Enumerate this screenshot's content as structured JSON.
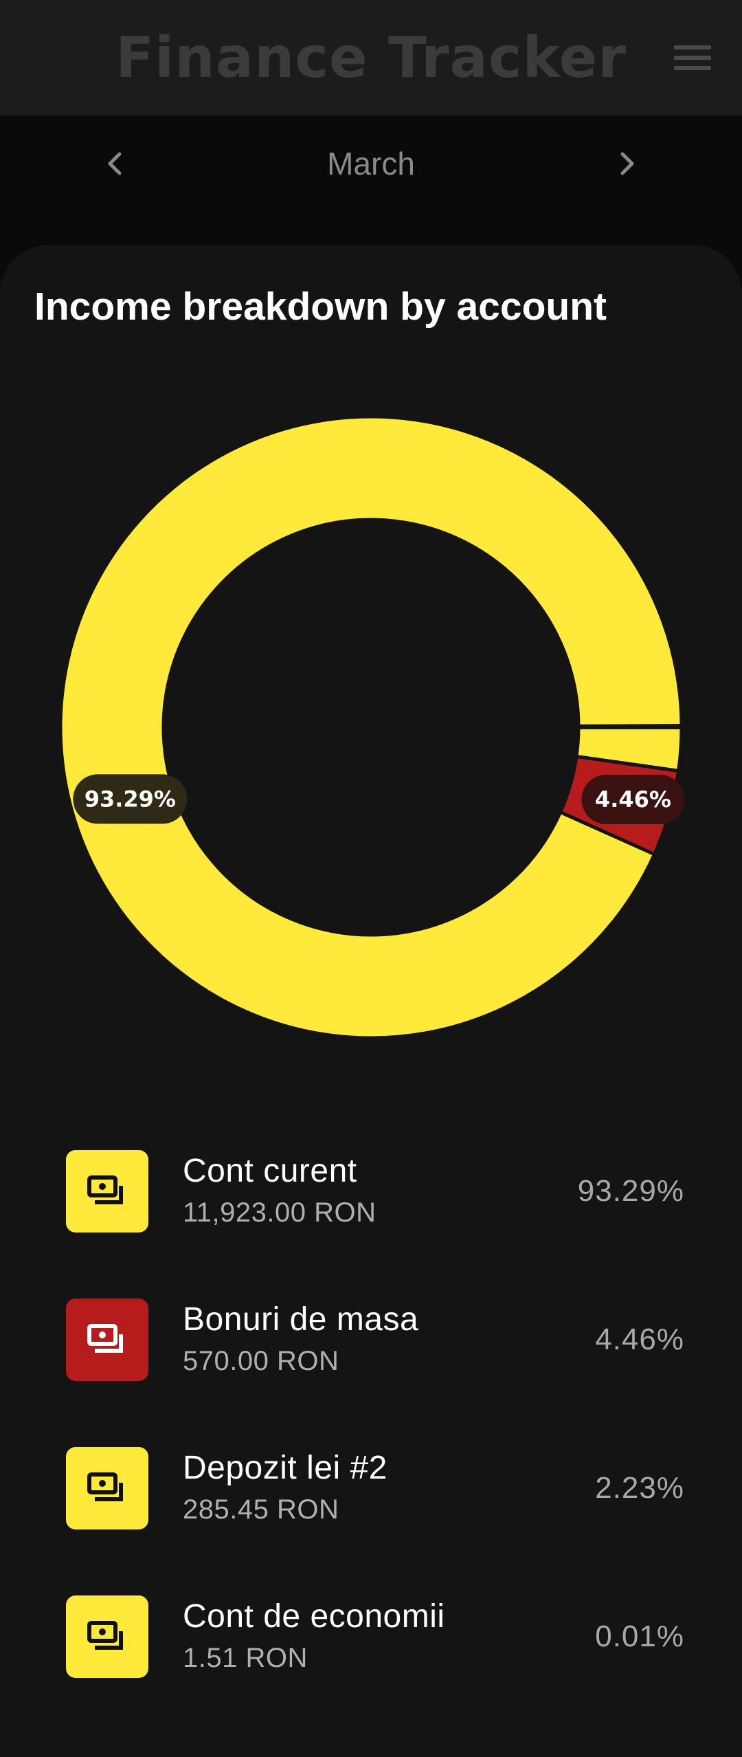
{
  "app": {
    "title": "Finance Tracker"
  },
  "header": {
    "menu_icon": "hamburger-menu-icon"
  },
  "month_nav": {
    "label": "March",
    "prev_icon": "chevron-left-icon",
    "next_icon": "chevron-right-icon"
  },
  "card": {
    "title": "Income breakdown by account"
  },
  "colors": {
    "yellow": "#FFE93A",
    "red": "#B71C1C",
    "background": "#141414"
  },
  "chart_data": {
    "type": "pie",
    "title": "Income breakdown by account",
    "categories": [
      "Cont curent",
      "Bonuri de masa",
      "Depozit lei #2",
      "Cont de economii"
    ],
    "values": [
      93.29,
      4.46,
      2.23,
      0.01
    ],
    "colors": [
      "#FFE93A",
      "#B71C1C",
      "#FFE93A",
      "#FFE93A"
    ],
    "data_labels": [
      "93.29%",
      "4.46%",
      "",
      ""
    ],
    "donut": true
  },
  "accounts": [
    {
      "name": "Cont curent",
      "amount": "11,923.00 RON",
      "percent": "93.29%",
      "color": "#FFE93A",
      "icon": "money-icon"
    },
    {
      "name": "Bonuri de masa",
      "amount": "570.00 RON",
      "percent": "4.46%",
      "color": "#B71C1C",
      "icon": "money-icon"
    },
    {
      "name": "Depozit lei #2",
      "amount": "285.45 RON",
      "percent": "2.23%",
      "color": "#FFE93A",
      "icon": "money-icon"
    },
    {
      "name": "Cont de economii",
      "amount": "1.51 RON",
      "percent": "0.01%",
      "color": "#FFE93A",
      "icon": "money-icon"
    }
  ]
}
